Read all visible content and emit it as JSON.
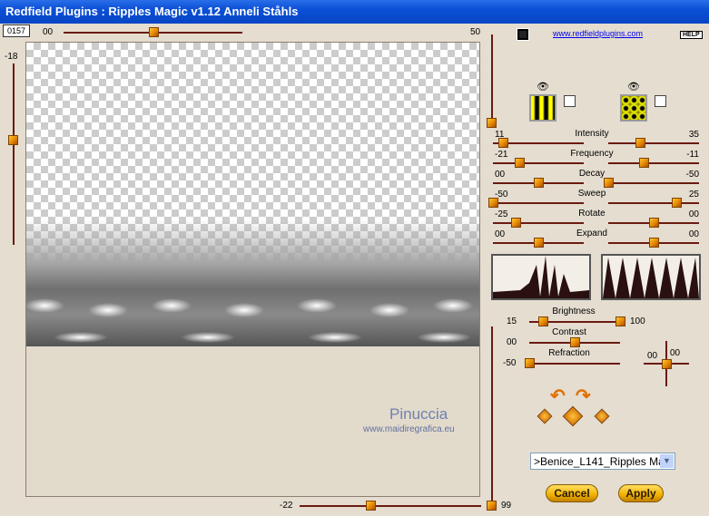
{
  "window": {
    "title": "Redfield Plugins : Ripples Magic v1.12   Anneli Ståhls"
  },
  "header": {
    "frame_number": "0157",
    "link": "www.redfieldplugins.com",
    "help_label": "HELP"
  },
  "top_slider": {
    "min_label": "00",
    "max_label": "50",
    "value": 0.5
  },
  "left_slider": {
    "label": "-18",
    "value": 0.42
  },
  "bottom_slider": {
    "label": "-22",
    "max_label": "99",
    "value": 0.39
  },
  "right_top_vslider": {
    "value": 0.97
  },
  "right_bottom_vslider": {
    "value": 1.0
  },
  "patterns": [
    {
      "name": "stripes",
      "checked": false
    },
    {
      "name": "dots",
      "checked": false
    }
  ],
  "ripple_params": [
    {
      "label": "Intensity",
      "left": {
        "value_label": "11",
        "value": 0.11
      },
      "right": {
        "value_label": "35",
        "value": 0.35
      }
    },
    {
      "label": "Frequency",
      "left": {
        "value_label": "-21",
        "value": 0.29
      },
      "right": {
        "value_label": "-11",
        "value": 0.39
      }
    },
    {
      "label": "Decay",
      "left": {
        "value_label": "00",
        "value": 0.5
      },
      "right": {
        "value_label": "-50",
        "value": 0.0
      }
    },
    {
      "label": "Sweep",
      "left": {
        "value_label": "-50",
        "value": 0.0
      },
      "right": {
        "value_label": "25",
        "value": 0.75
      }
    },
    {
      "label": "Rotate",
      "left": {
        "value_label": "-25",
        "value": 0.25
      },
      "right": {
        "value_label": "00",
        "value": 0.5
      }
    },
    {
      "label": "Expand",
      "left": {
        "value_label": "00",
        "value": 0.5
      },
      "right": {
        "value_label": "00",
        "value": 0.5
      }
    }
  ],
  "lighting": {
    "brightness": {
      "label": "Brightness",
      "low_label": "15",
      "high_label": "100",
      "low": 0.15,
      "high": 1.0
    },
    "contrast": {
      "label": "Contrast",
      "value_label": "00",
      "value": 0.5
    },
    "refraction": {
      "label": "Refraction",
      "value_label": "-50",
      "value": 0.0
    },
    "offset": {
      "x_label": "00",
      "y_label": "00"
    }
  },
  "preset": {
    "selected": ">Benice_L141_Ripples Ma"
  },
  "buttons": {
    "cancel": "Cancel",
    "apply": "Apply"
  },
  "watermark": {
    "name": "Pinuccia",
    "url": "www.maidiregrafica.eu"
  },
  "colors": {
    "title_bar": "#0a4fd6",
    "track": "#6b1a10",
    "knob": "#f0a000",
    "background": "#e4ddd0"
  }
}
